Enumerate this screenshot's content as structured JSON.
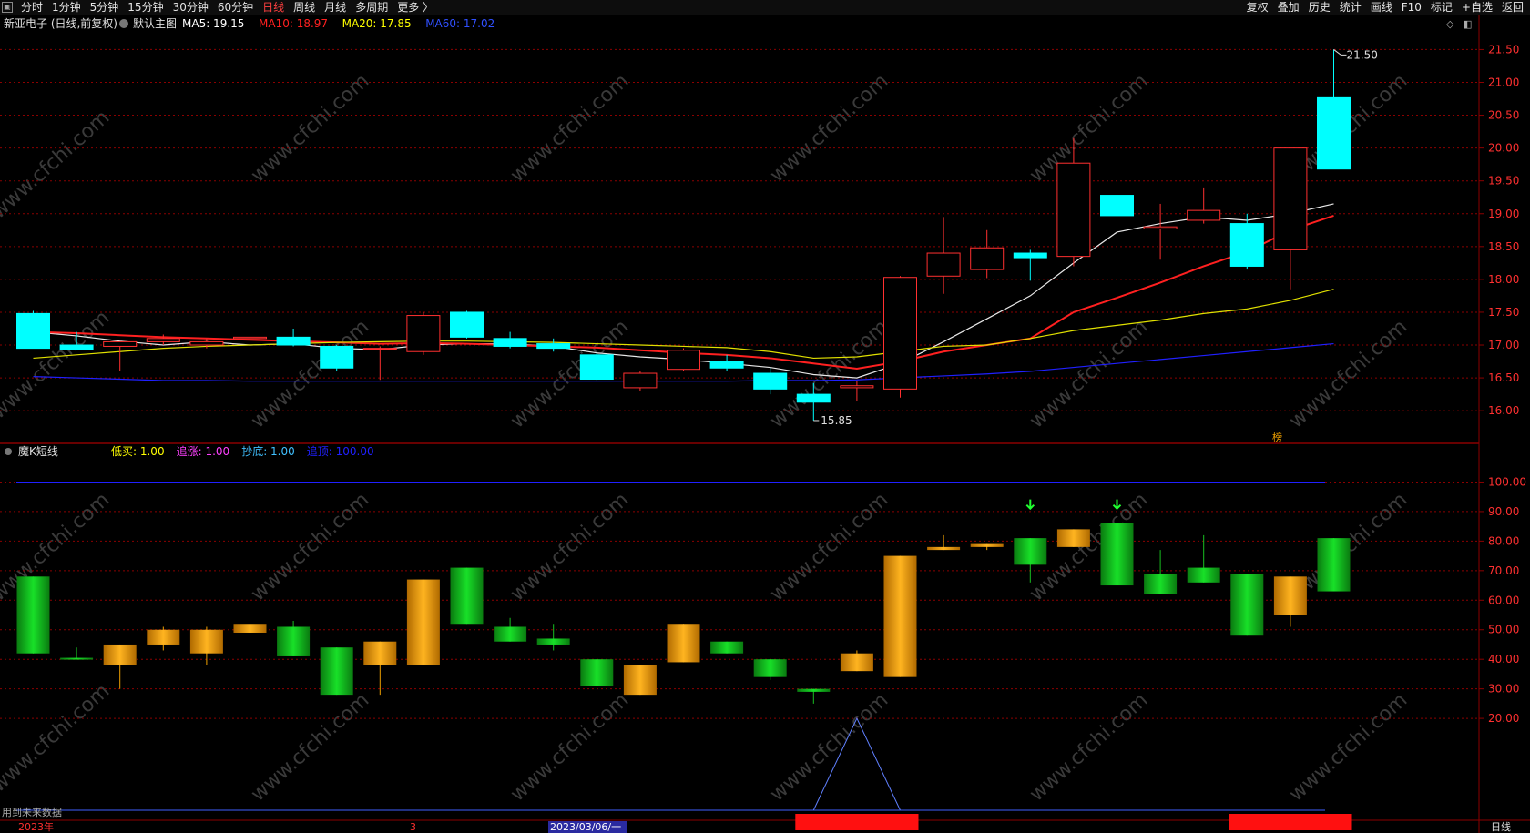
{
  "toolbar": {
    "left_buttons": [
      "分时",
      "1分钟",
      "5分钟",
      "15分钟",
      "30分钟",
      "60分钟",
      "日线",
      "周线",
      "月线",
      "多周期",
      "更多 〉"
    ],
    "active": "日线",
    "right_buttons": [
      "复权",
      "叠加",
      "历史",
      "统计",
      "画线",
      "F10",
      "标记",
      "+自选",
      "返回"
    ]
  },
  "main_chart": {
    "title": "新亚电子 (日线,前复权)",
    "template_label": "默认主图",
    "ma_legend": [
      {
        "label": "MA5: 19.15",
        "color": "#ffffff"
      },
      {
        "label": "MA10: 18.97",
        "color": "#ff2020"
      },
      {
        "label": "MA20: 17.85",
        "color": "#ffff00"
      },
      {
        "label": "MA60: 17.02",
        "color": "#2020ff"
      }
    ],
    "high_marker": "21.50",
    "low_marker": "15.85",
    "badge": "榜"
  },
  "sub_chart": {
    "title": "魔K短线",
    "legend": [
      {
        "label": "低买: 1.00",
        "color": "#ffff00"
      },
      {
        "label": "追涨: 1.00",
        "color": "#ff40ff"
      },
      {
        "label": "抄底: 1.00",
        "color": "#40c0ff"
      },
      {
        "label": "追顶: 100.00",
        "color": "#2020ff"
      }
    ],
    "footnote": "用到未来数据"
  },
  "bottom_axis": {
    "year": "2023年",
    "month_mark": "3",
    "cursor_date": "2023/03/06/一",
    "period": "日线"
  },
  "watermark": "www.cfchi.com",
  "colors": {
    "up": "#ff3030",
    "down": "#00ffff",
    "green_bar": "#10c020",
    "orange_bar": "#f0a000",
    "grid": "#8b0000"
  },
  "chart_data": [
    {
      "type": "candlestick",
      "title": "新亚电子 (日线,前复权)",
      "ylim": [
        15.6,
        21.7
      ],
      "y_ticks": [
        16.0,
        16.5,
        17.0,
        17.5,
        18.0,
        18.5,
        19.0,
        19.5,
        20.0,
        20.5,
        21.0,
        21.5
      ],
      "candles": [
        {
          "o": 17.48,
          "h": 17.52,
          "l": 16.95,
          "c": 16.95
        },
        {
          "o": 17.0,
          "h": 17.2,
          "l": 16.92,
          "c": 16.93
        },
        {
          "o": 16.98,
          "h": 17.02,
          "l": 16.6,
          "c": 17.05
        },
        {
          "o": 17.05,
          "h": 17.16,
          "l": 17.0,
          "c": 17.1
        },
        {
          "o": 17.0,
          "h": 17.1,
          "l": 16.95,
          "c": 17.05
        },
        {
          "o": 17.1,
          "h": 17.18,
          "l": 17.05,
          "c": 17.12
        },
        {
          "o": 17.12,
          "h": 17.25,
          "l": 16.98,
          "c": 17.0
        },
        {
          "o": 16.98,
          "h": 17.0,
          "l": 16.6,
          "c": 16.65
        },
        {
          "o": 16.95,
          "h": 16.98,
          "l": 16.47,
          "c": 16.95
        },
        {
          "o": 16.9,
          "h": 17.5,
          "l": 16.85,
          "c": 17.45
        },
        {
          "o": 17.5,
          "h": 17.52,
          "l": 17.1,
          "c": 17.12
        },
        {
          "o": 17.1,
          "h": 17.2,
          "l": 16.95,
          "c": 16.98
        },
        {
          "o": 17.02,
          "h": 17.1,
          "l": 16.9,
          "c": 16.95
        },
        {
          "o": 16.85,
          "h": 16.88,
          "l": 16.47,
          "c": 16.48
        },
        {
          "o": 16.35,
          "h": 16.6,
          "l": 16.3,
          "c": 16.57
        },
        {
          "o": 16.63,
          "h": 16.95,
          "l": 16.6,
          "c": 16.92
        },
        {
          "o": 16.75,
          "h": 16.85,
          "l": 16.6,
          "c": 16.65
        },
        {
          "o": 16.57,
          "h": 16.65,
          "l": 16.25,
          "c": 16.33
        },
        {
          "o": 16.25,
          "h": 16.42,
          "l": 15.85,
          "c": 16.13
        },
        {
          "o": 16.35,
          "h": 16.45,
          "l": 16.15,
          "c": 16.38
        },
        {
          "o": 16.33,
          "h": 18.05,
          "l": 16.2,
          "c": 18.03
        },
        {
          "o": 18.05,
          "h": 18.95,
          "l": 17.78,
          "c": 18.4
        },
        {
          "o": 18.15,
          "h": 18.75,
          "l": 18.02,
          "c": 18.48
        },
        {
          "o": 18.4,
          "h": 18.45,
          "l": 17.98,
          "c": 18.33
        },
        {
          "o": 18.35,
          "h": 20.15,
          "l": 18.2,
          "c": 19.77
        },
        {
          "o": 19.28,
          "h": 19.3,
          "l": 18.4,
          "c": 18.97
        },
        {
          "o": 18.77,
          "h": 19.15,
          "l": 18.3,
          "c": 18.8
        },
        {
          "o": 18.9,
          "h": 19.4,
          "l": 18.85,
          "c": 19.05
        },
        {
          "o": 18.85,
          "h": 19.0,
          "l": 18.15,
          "c": 18.2
        },
        {
          "o": 18.45,
          "h": 20.0,
          "l": 17.85,
          "c": 20.0
        },
        {
          "o": 20.78,
          "h": 21.5,
          "l": 19.68,
          "c": 19.68
        }
      ],
      "series": [
        {
          "name": "MA5",
          "values": [
            17.2,
            17.14,
            17.06,
            17.0,
            17.05,
            17.0,
            17.02,
            16.95,
            16.93,
            17.0,
            17.02,
            17.02,
            16.98,
            16.88,
            16.82,
            16.78,
            16.72,
            16.66,
            16.55,
            16.5,
            16.72,
            17.05,
            17.4,
            17.75,
            18.25,
            18.72,
            18.85,
            18.95,
            18.9,
            19.0,
            19.15
          ]
        },
        {
          "name": "MA10",
          "values": [
            17.2,
            17.18,
            17.15,
            17.12,
            17.1,
            17.08,
            17.06,
            17.04,
            17.02,
            17.03,
            17.02,
            17.0,
            16.98,
            16.96,
            16.92,
            16.88,
            16.85,
            16.8,
            16.72,
            16.64,
            16.75,
            16.9,
            17.0,
            17.1,
            17.5,
            17.72,
            17.95,
            18.2,
            18.42,
            18.75,
            18.97
          ]
        },
        {
          "name": "MA20",
          "values": [
            16.8,
            16.85,
            16.9,
            16.95,
            16.98,
            17.0,
            17.02,
            17.04,
            17.05,
            17.06,
            17.06,
            17.05,
            17.04,
            17.02,
            17.0,
            16.98,
            16.96,
            16.9,
            16.8,
            16.82,
            16.9,
            16.98,
            17.0,
            17.1,
            17.22,
            17.3,
            17.38,
            17.48,
            17.55,
            17.68,
            17.85
          ]
        },
        {
          "name": "MA60",
          "values": [
            16.52,
            16.5,
            16.48,
            16.46,
            16.46,
            16.45,
            16.45,
            16.45,
            16.45,
            16.45,
            16.45,
            16.45,
            16.45,
            16.45,
            16.45,
            16.45,
            16.45,
            16.46,
            16.46,
            16.47,
            16.5,
            16.53,
            16.56,
            16.6,
            16.66,
            16.72,
            16.78,
            16.84,
            16.9,
            16.96,
            17.02
          ]
        }
      ]
    },
    {
      "type": "bar",
      "title": "魔K短线",
      "ylim": [
        0,
        106
      ],
      "y_ticks": [
        20,
        30,
        40,
        50,
        60,
        70,
        80,
        90,
        100
      ],
      "bars": [
        {
          "o": 68,
          "c": 42,
          "h": 68,
          "l": 42,
          "color": "green"
        },
        {
          "o": 40.5,
          "c": 40,
          "h": 44,
          "l": 40,
          "color": "green"
        },
        {
          "o": 38,
          "c": 45,
          "h": 45,
          "l": 30,
          "color": "orange"
        },
        {
          "o": 45,
          "c": 50,
          "h": 51,
          "l": 43,
          "color": "orange"
        },
        {
          "o": 42,
          "c": 50,
          "h": 51,
          "l": 38,
          "color": "orange"
        },
        {
          "o": 49,
          "c": 52,
          "h": 55,
          "l": 43,
          "color": "orange"
        },
        {
          "o": 51,
          "c": 41,
          "h": 53,
          "l": 41,
          "color": "green"
        },
        {
          "o": 44,
          "c": 28,
          "h": 44,
          "l": 28,
          "color": "green"
        },
        {
          "o": 38,
          "c": 46,
          "h": 46,
          "l": 28,
          "color": "orange"
        },
        {
          "o": 38,
          "c": 67,
          "h": 67,
          "l": 38,
          "color": "orange"
        },
        {
          "o": 71,
          "c": 52,
          "h": 71,
          "l": 52,
          "color": "green"
        },
        {
          "o": 51,
          "c": 46,
          "h": 54,
          "l": 46,
          "color": "green"
        },
        {
          "o": 47,
          "c": 45,
          "h": 52,
          "l": 43,
          "color": "green"
        },
        {
          "o": 40,
          "c": 31,
          "h": 40,
          "l": 31,
          "color": "green"
        },
        {
          "o": 28,
          "c": 38,
          "h": 38,
          "l": 28,
          "color": "orange"
        },
        {
          "o": 39,
          "c": 52,
          "h": 52,
          "l": 39,
          "color": "orange"
        },
        {
          "o": 46,
          "c": 42,
          "h": 46,
          "l": 42,
          "color": "green"
        },
        {
          "o": 40,
          "c": 34,
          "h": 40,
          "l": 33,
          "color": "green"
        },
        {
          "o": 30,
          "c": 29,
          "h": 30,
          "l": 25,
          "color": "green"
        },
        {
          "o": 36,
          "c": 42,
          "h": 43,
          "l": 36,
          "color": "orange"
        },
        {
          "o": 34,
          "c": 75,
          "h": 75,
          "l": 34,
          "color": "orange"
        },
        {
          "o": 77,
          "c": 78,
          "h": 82,
          "l": 77,
          "color": "orange"
        },
        {
          "o": 78,
          "c": 79,
          "h": 79,
          "l": 77,
          "color": "orange"
        },
        {
          "o": 81,
          "c": 72,
          "h": 81,
          "l": 66,
          "color": "green"
        },
        {
          "o": 78,
          "c": 84,
          "h": 84,
          "l": 78,
          "color": "orange"
        },
        {
          "o": 86,
          "c": 65,
          "h": 86,
          "l": 65,
          "color": "green"
        },
        {
          "o": 69,
          "c": 62,
          "h": 77,
          "l": 62,
          "color": "green"
        },
        {
          "o": 71,
          "c": 66,
          "h": 82,
          "l": 66,
          "color": "green"
        },
        {
          "o": 69,
          "c": 48,
          "h": 69,
          "l": 48,
          "color": "green"
        },
        {
          "o": 55,
          "c": 68,
          "h": 68,
          "l": 51,
          "color": "orange"
        },
        {
          "o": 81,
          "c": 63,
          "h": 81,
          "l": 63,
          "color": "green"
        }
      ],
      "signal_arrows_at": [
        23,
        25
      ],
      "triangle_signal_at": 19,
      "red_markers_at": [
        [
          18,
          20
        ],
        [
          28,
          30
        ]
      ]
    }
  ]
}
